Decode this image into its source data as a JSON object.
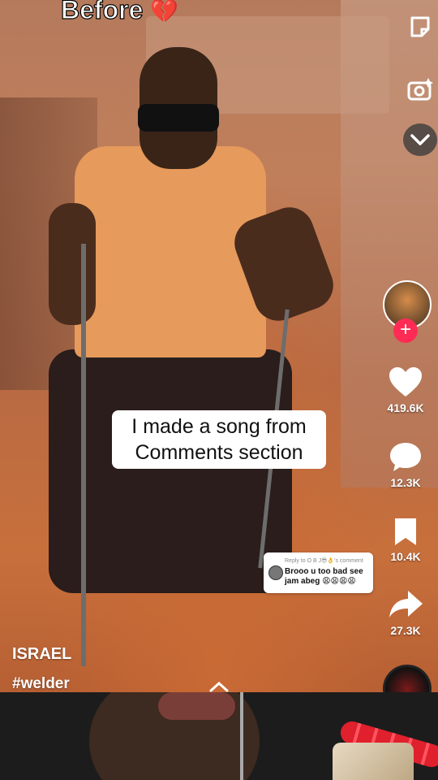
{
  "overlay": {
    "top_text": "Before",
    "top_emoji": "💔",
    "caption_line1": "I made a song from",
    "caption_line2": "Comments section"
  },
  "reply_card": {
    "label": "Reply to O B J😎👌's comment",
    "text": "Brooo u too bad see jam abeg 😩😩😩😩"
  },
  "actions": {
    "likes": "419.6K",
    "comments": "12.3K",
    "saves": "10.4K",
    "shares": "27.3K"
  },
  "author": {
    "username": "ISRAEL",
    "hashtag": "#welder"
  },
  "icons": {
    "top_right_1": "filter-icon",
    "top_right_2": "camera-flip-icon",
    "collapse": "chevron-down-icon",
    "up": "chevron-up-icon",
    "heart": "heart-icon",
    "comment": "comment-icon",
    "bookmark": "bookmark-icon",
    "share": "share-icon"
  },
  "colors": {
    "accent": "#fe2c55",
    "white": "#ffffff"
  }
}
